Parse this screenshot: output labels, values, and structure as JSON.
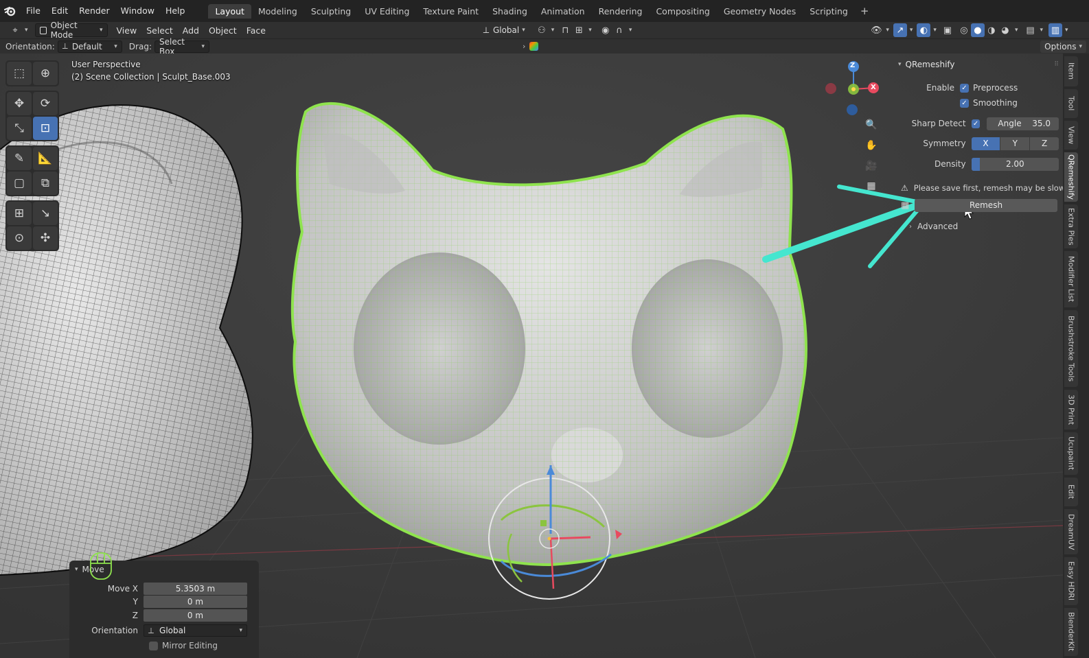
{
  "menubar": {
    "items": [
      "File",
      "Edit",
      "Render",
      "Window",
      "Help"
    ],
    "workspaces": [
      "Layout",
      "Modeling",
      "Sculpting",
      "UV Editing",
      "Texture Paint",
      "Shading",
      "Animation",
      "Rendering",
      "Compositing",
      "Geometry Nodes",
      "Scripting"
    ],
    "active_workspace": "Layout",
    "add_tab": "+"
  },
  "header": {
    "mode": "Object Mode",
    "menus": [
      "View",
      "Select",
      "Add",
      "Object",
      "Face"
    ],
    "transform_orientation": "Global"
  },
  "tool_settings": {
    "orientation_label": "Orientation:",
    "orientation_value": "Default",
    "drag_label": "Drag:",
    "drag_value": "Select Box",
    "options": "Options"
  },
  "viewport": {
    "perspective": "User Perspective",
    "collection": "(2) Scene Collection | Sculpt_Base.003",
    "gizmo_axes": {
      "z": "Z",
      "x": "X"
    }
  },
  "qremeshify": {
    "title": "QRemeshify",
    "enable_label": "Enable",
    "preprocess_label": "Preprocess",
    "preprocess_checked": true,
    "smoothing_label": "Smoothing",
    "smoothing_checked": true,
    "sharp_detect_label": "Sharp Detect",
    "sharp_detect_checked": true,
    "angle_label": "Angle",
    "angle_value": "35.0",
    "symmetry_label": "Symmetry",
    "symmetry_axes": [
      "X",
      "Y",
      "Z"
    ],
    "symmetry_active": "X",
    "density_label": "Density",
    "density_value": "2.00",
    "density_fill": 0.1,
    "warning": "Please save first, remesh may be slow",
    "remesh_label": "Remesh",
    "advanced_label": "Advanced"
  },
  "sidebar_tabs": [
    "Item",
    "Tool",
    "View",
    "QRemeshify",
    "Extra Pies",
    "Modifier List",
    "Brushstroke Tools",
    "3D Print",
    "Ucupaint",
    "Edit",
    "DreamUV",
    "Easy HDRI",
    "BlenderKit"
  ],
  "active_sidebar_tab": "QRemeshify",
  "operator_panel": {
    "title": "Move",
    "move_x_label": "Move X",
    "move_x_value": "5.3503 m",
    "y_label": "Y",
    "y_value": "0 m",
    "z_label": "Z",
    "z_value": "0 m",
    "orientation_label": "Orientation",
    "orientation_value": "Global",
    "mirror_label": "Mirror Editing",
    "mirror_checked": false
  },
  "colors": {
    "accent": "#4772b3",
    "selection_outline": "#8fe34e",
    "annotation_arrow": "#45e6cf",
    "axis_x": "#e84a5f",
    "axis_y": "#8bc43f",
    "axis_z": "#4a8ad8"
  }
}
